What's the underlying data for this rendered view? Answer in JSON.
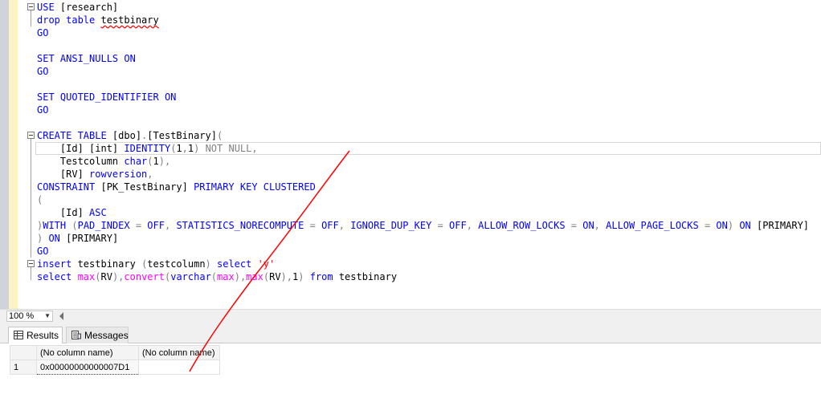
{
  "editor": {
    "lines": [
      {
        "parts": [
          {
            "t": "USE",
            "c": "kw"
          },
          {
            "t": " [research]",
            "c": "dk"
          }
        ]
      },
      {
        "parts": [
          {
            "t": "drop table ",
            "c": "kw"
          },
          {
            "t": "testbinary",
            "c": "dk sq"
          }
        ]
      },
      {
        "parts": [
          {
            "t": "GO",
            "c": "kw"
          }
        ]
      },
      {
        "parts": []
      },
      {
        "parts": [
          {
            "t": "SET ANSI_NULLS ON",
            "c": "kw"
          }
        ]
      },
      {
        "parts": [
          {
            "t": "GO",
            "c": "kw"
          }
        ]
      },
      {
        "parts": []
      },
      {
        "parts": [
          {
            "t": "SET QUOTED_IDENTIFIER ON",
            "c": "kw"
          }
        ]
      },
      {
        "parts": [
          {
            "t": "GO",
            "c": "kw"
          }
        ]
      },
      {
        "parts": []
      },
      {
        "parts": [
          {
            "t": "CREATE TABLE ",
            "c": "kw"
          },
          {
            "t": "[dbo]",
            "c": "dk"
          },
          {
            "t": ".",
            "c": "gr"
          },
          {
            "t": "[TestBinary]",
            "c": "dk"
          },
          {
            "t": "(",
            "c": "gr"
          }
        ]
      },
      {
        "parts": [
          {
            "t": "    [Id] ",
            "c": "dk"
          },
          {
            "t": "[int] ",
            "c": "dk"
          },
          {
            "t": "IDENTITY",
            "c": "kw"
          },
          {
            "t": "(",
            "c": "gr"
          },
          {
            "t": "1",
            "c": "dk"
          },
          {
            "t": ",",
            "c": "gr"
          },
          {
            "t": "1",
            "c": "dk"
          },
          {
            "t": ") NOT NULL,",
            "c": "gr"
          }
        ]
      },
      {
        "parts": [
          {
            "t": "    Testcolumn ",
            "c": "dk"
          },
          {
            "t": "char",
            "c": "kw"
          },
          {
            "t": "(",
            "c": "gr"
          },
          {
            "t": "1",
            "c": "dk"
          },
          {
            "t": "),",
            "c": "gr"
          }
        ]
      },
      {
        "parts": [
          {
            "t": "    [RV] ",
            "c": "dk"
          },
          {
            "t": "rowversion",
            "c": "kw"
          },
          {
            "t": ",",
            "c": "gr"
          }
        ]
      },
      {
        "parts": [
          {
            "t": "CONSTRAINT ",
            "c": "kw"
          },
          {
            "t": "[PK_TestBinary] ",
            "c": "dk"
          },
          {
            "t": "PRIMARY KEY CLUSTERED",
            "c": "kw"
          }
        ]
      },
      {
        "parts": [
          {
            "t": "(",
            "c": "gr"
          }
        ]
      },
      {
        "parts": [
          {
            "t": "    [Id] ",
            "c": "dk"
          },
          {
            "t": "ASC",
            "c": "kw"
          }
        ]
      },
      {
        "parts": [
          {
            "t": ")",
            "c": "gr"
          },
          {
            "t": "WITH ",
            "c": "kw"
          },
          {
            "t": "(",
            "c": "gr"
          },
          {
            "t": "PAD_INDEX ",
            "c": "kw"
          },
          {
            "t": "= ",
            "c": "gr"
          },
          {
            "t": "OFF",
            "c": "kw"
          },
          {
            "t": ", ",
            "c": "gr"
          },
          {
            "t": "STATISTICS_NORECOMPUTE ",
            "c": "kw"
          },
          {
            "t": "= ",
            "c": "gr"
          },
          {
            "t": "OFF",
            "c": "kw"
          },
          {
            "t": ", ",
            "c": "gr"
          },
          {
            "t": "IGNORE_DUP_KEY ",
            "c": "kw"
          },
          {
            "t": "= ",
            "c": "gr"
          },
          {
            "t": "OFF",
            "c": "kw"
          },
          {
            "t": ", ",
            "c": "gr"
          },
          {
            "t": "ALLOW_ROW_LOCKS ",
            "c": "kw"
          },
          {
            "t": "= ",
            "c": "gr"
          },
          {
            "t": "ON",
            "c": "kw"
          },
          {
            "t": ", ",
            "c": "gr"
          },
          {
            "t": "ALLOW_PAGE_LOCKS ",
            "c": "kw"
          },
          {
            "t": "= ",
            "c": "gr"
          },
          {
            "t": "ON",
            "c": "kw"
          },
          {
            "t": ") ",
            "c": "gr"
          },
          {
            "t": "ON ",
            "c": "kw"
          },
          {
            "t": "[PRIMARY]",
            "c": "dk"
          }
        ]
      },
      {
        "parts": [
          {
            "t": ") ",
            "c": "gr"
          },
          {
            "t": "ON ",
            "c": "kw"
          },
          {
            "t": "[PRIMARY]",
            "c": "dk"
          }
        ]
      },
      {
        "parts": [
          {
            "t": "GO",
            "c": "kw"
          }
        ]
      },
      {
        "parts": [
          {
            "t": "insert ",
            "c": "kw"
          },
          {
            "t": "testbinary ",
            "c": "dk"
          },
          {
            "t": "(",
            "c": "gr"
          },
          {
            "t": "testcolumn",
            "c": "dk"
          },
          {
            "t": ") ",
            "c": "gr"
          },
          {
            "t": "select ",
            "c": "kw"
          },
          {
            "t": "'y'",
            "c": "str"
          }
        ]
      },
      {
        "parts": [
          {
            "t": "select ",
            "c": "kw"
          },
          {
            "t": "max",
            "c": "fn"
          },
          {
            "t": "(",
            "c": "gr"
          },
          {
            "t": "RV",
            "c": "dk"
          },
          {
            "t": "),",
            "c": "gr"
          },
          {
            "t": "convert",
            "c": "fn"
          },
          {
            "t": "(",
            "c": "gr"
          },
          {
            "t": "varchar",
            "c": "kw"
          },
          {
            "t": "(",
            "c": "gr"
          },
          {
            "t": "max",
            "c": "fn"
          },
          {
            "t": "),",
            "c": "gr"
          },
          {
            "t": "max",
            "c": "fn"
          },
          {
            "t": "(",
            "c": "gr"
          },
          {
            "t": "RV",
            "c": "dk"
          },
          {
            "t": "),",
            "c": "gr"
          },
          {
            "t": "1",
            "c": "dk"
          },
          {
            "t": ") ",
            "c": "gr"
          },
          {
            "t": "from ",
            "c": "kw"
          },
          {
            "t": "testbinary",
            "c": "dk"
          }
        ]
      }
    ]
  },
  "zoom": {
    "value": "100 %"
  },
  "tabs": {
    "results": "Results",
    "messages": "Messages"
  },
  "grid": {
    "headers": [
      "(No column name)",
      "(No column name)"
    ],
    "rows": [
      {
        "num": "1",
        "cells": [
          "0x00000000000007D1",
          ""
        ]
      }
    ]
  },
  "colors": {
    "keyword": "#0000ff",
    "function": "#ff00ff",
    "operator": "#808080",
    "string": "#ff0000",
    "annotation": "#ff0000"
  }
}
